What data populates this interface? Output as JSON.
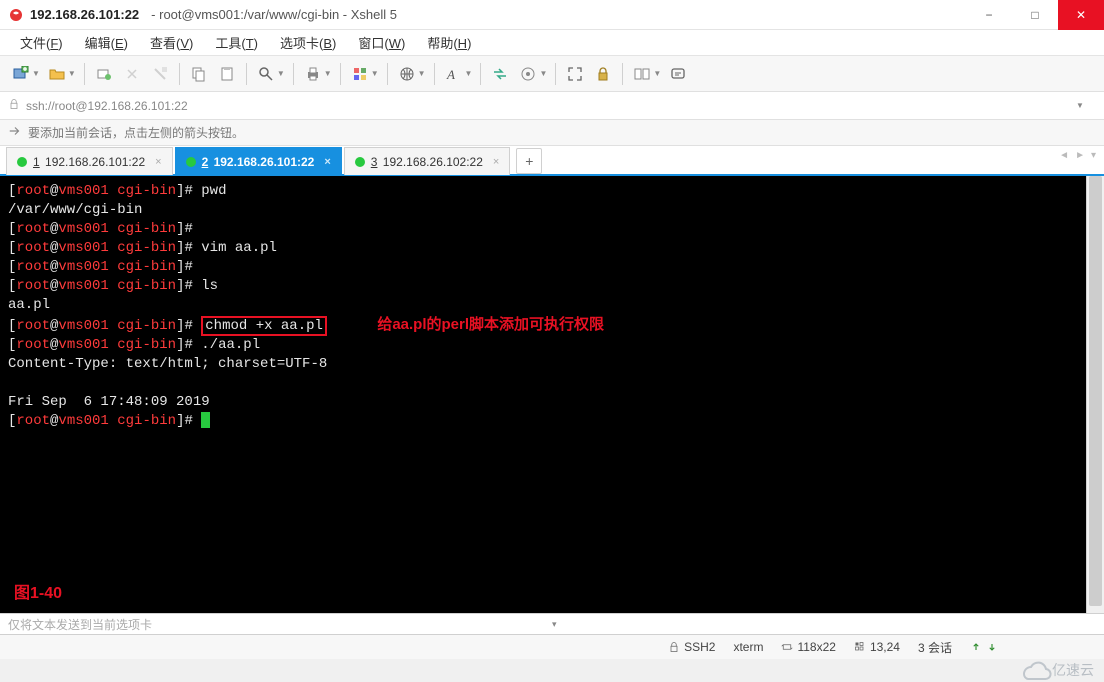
{
  "title": {
    "ip": "192.168.26.101:22",
    "sub": "root@vms001:/var/www/cgi-bin - Xshell 5"
  },
  "window_controls": {
    "min": "−",
    "max": "□",
    "close": "✕"
  },
  "menu": [
    {
      "label": "文件",
      "hotkey": "F"
    },
    {
      "label": "编辑",
      "hotkey": "E"
    },
    {
      "label": "查看",
      "hotkey": "V"
    },
    {
      "label": "工具",
      "hotkey": "T"
    },
    {
      "label": "选项卡",
      "hotkey": "B"
    },
    {
      "label": "窗口",
      "hotkey": "W"
    },
    {
      "label": "帮助",
      "hotkey": "H"
    }
  ],
  "address": {
    "url": "ssh://root@192.168.26.101:22"
  },
  "hint": "要添加当前会话，点击左侧的箭头按钮。",
  "tabs": [
    {
      "num": "1",
      "label": "192.168.26.101:22",
      "active": false,
      "status": "green"
    },
    {
      "num": "2",
      "label": "192.168.26.101:22",
      "active": true,
      "status": "green"
    },
    {
      "num": "3",
      "label": "192.168.26.102:22",
      "active": false,
      "status": "green"
    }
  ],
  "terminal": {
    "prompt_user": "root",
    "prompt_host": "vms001",
    "prompt_dir": "cgi-bin",
    "lines": [
      {
        "cmd": "pwd"
      },
      {
        "out": "/var/www/cgi-bin"
      },
      {
        "cmd": ""
      },
      {
        "cmd": "vim aa.pl"
      },
      {
        "cmd": ""
      },
      {
        "cmd": "ls"
      },
      {
        "out": "aa.pl"
      },
      {
        "cmd": "chmod +x aa.pl",
        "boxed": true,
        "anno": "给aa.pl的perl脚本添加可执行权限"
      },
      {
        "cmd": "./aa.pl"
      },
      {
        "out": "Content-Type: text/html; charset=UTF-8"
      },
      {
        "out": ""
      },
      {
        "out": "Fri Sep  6 17:48:09 2019"
      },
      {
        "cmd": "",
        "cursor": true
      }
    ],
    "fig_label": "图1-40"
  },
  "input_placeholder": "仅将文本发送到当前选项卡",
  "status": {
    "proto": "SSH2",
    "term": "xterm",
    "size": "118x22",
    "pos": "13,24",
    "sessions": "3 会话"
  },
  "watermark": "亿速云"
}
